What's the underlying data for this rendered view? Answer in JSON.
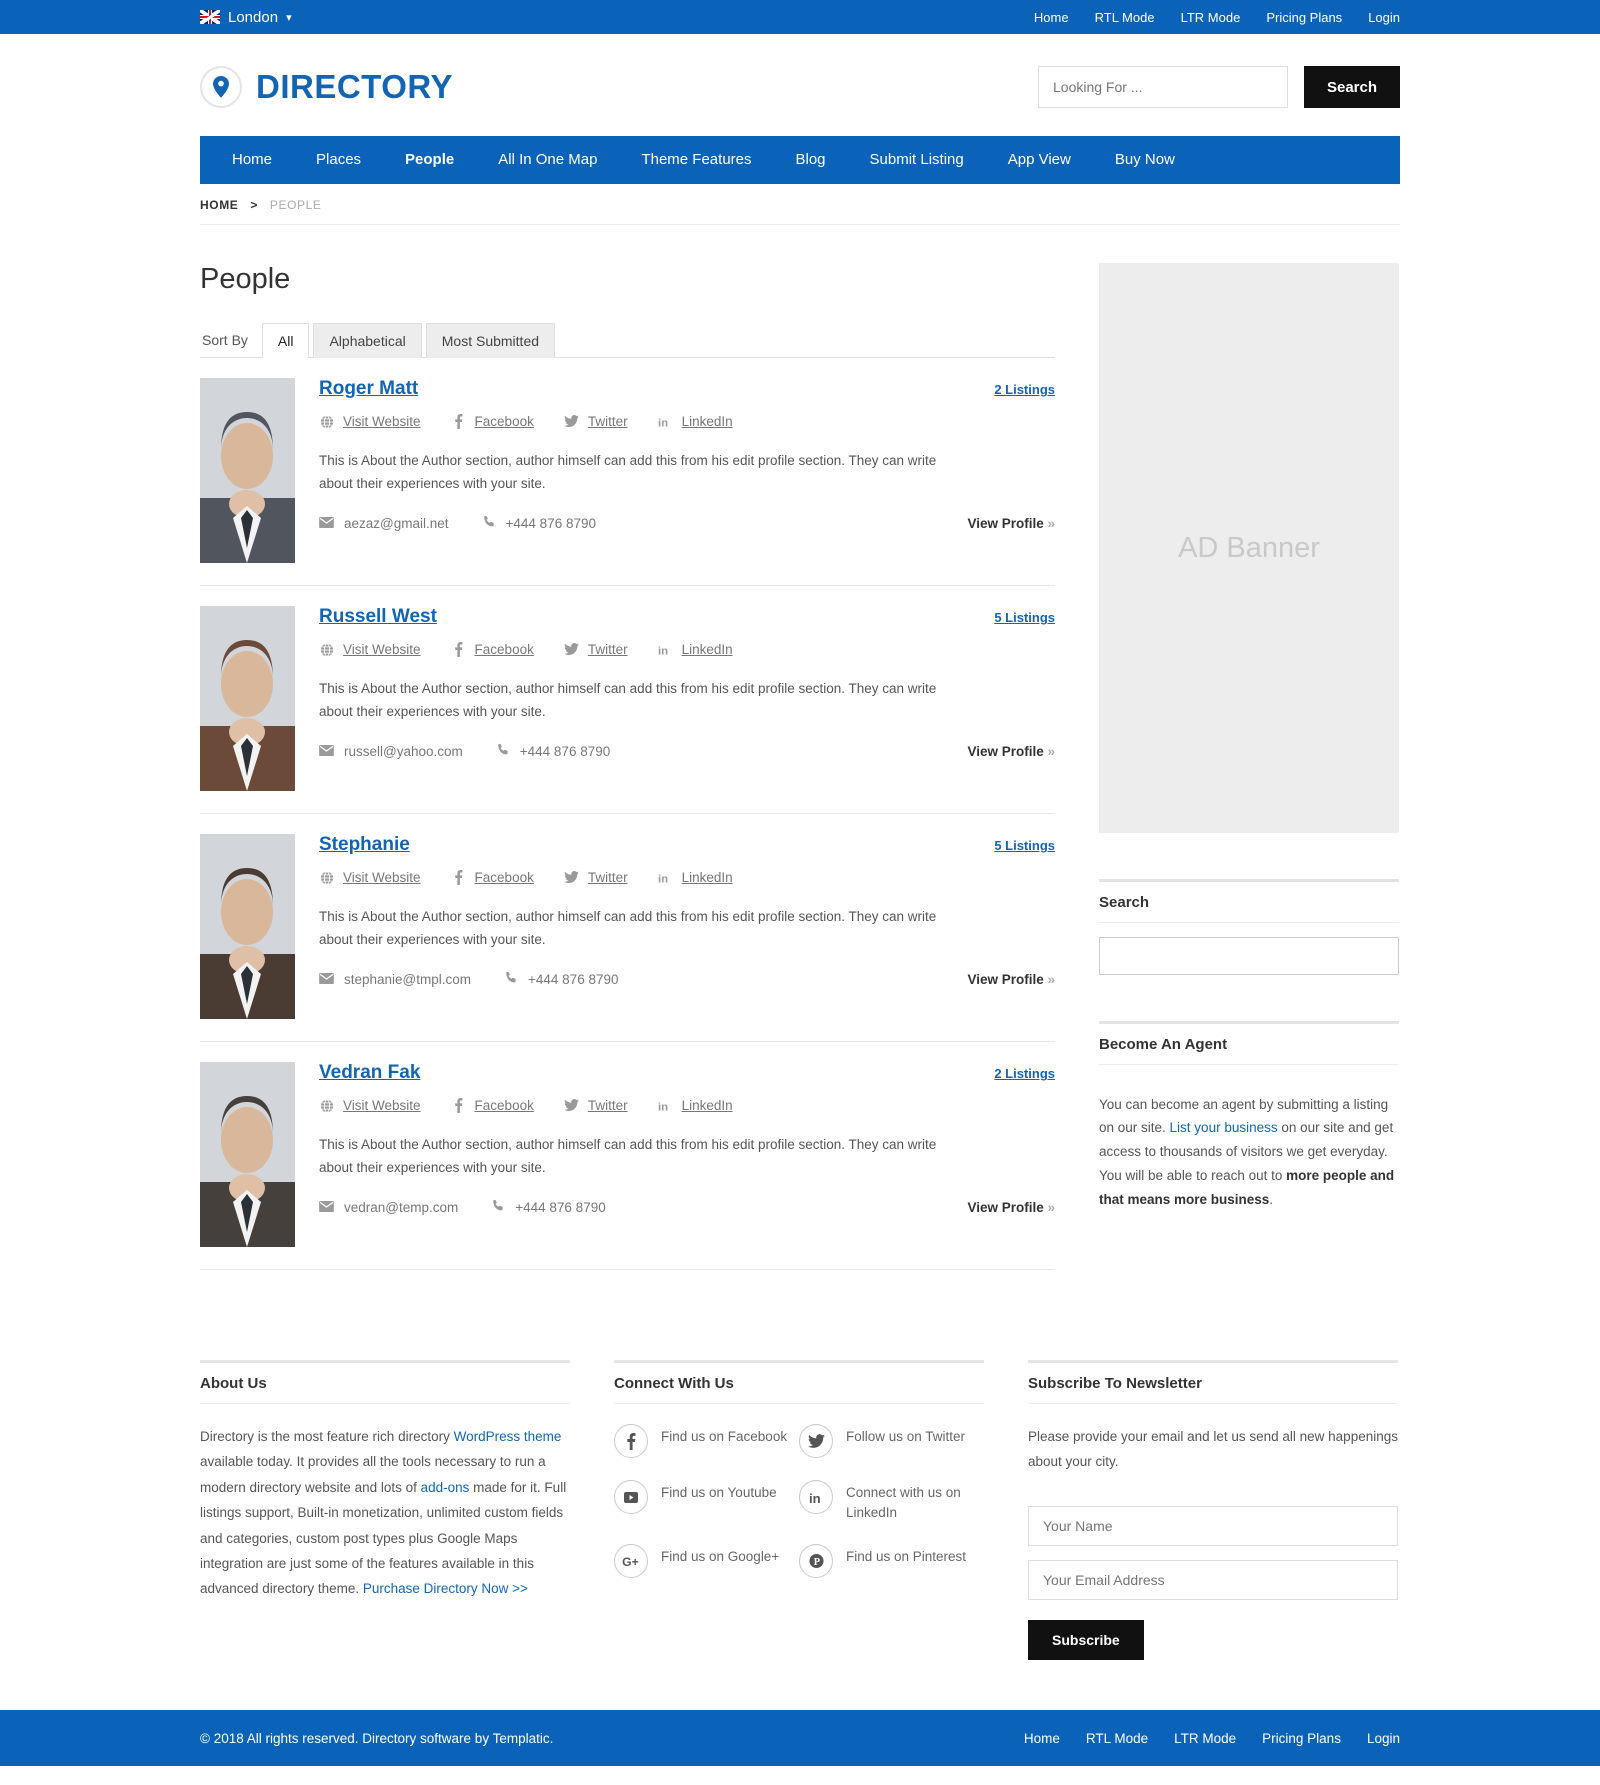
{
  "topbar": {
    "city": "London",
    "flag_icon": "uk-flag-icon",
    "caret_icon": "chevron-down-icon",
    "links": [
      {
        "label": "Home"
      },
      {
        "label": "RTL Mode"
      },
      {
        "label": "LTR Mode"
      },
      {
        "label": "Pricing Plans"
      },
      {
        "label": "Login"
      }
    ]
  },
  "header": {
    "logo_text": "DIRECTORY",
    "logo_icon": "map-pin-icon",
    "search_placeholder": "Looking For ...",
    "search_value": "",
    "search_button": "Search"
  },
  "mainnav": {
    "items": [
      {
        "label": "Home",
        "active": false
      },
      {
        "label": "Places",
        "active": false
      },
      {
        "label": "People",
        "active": true
      },
      {
        "label": "All In One Map",
        "active": false
      },
      {
        "label": "Theme Features",
        "active": false
      },
      {
        "label": "Blog",
        "active": false
      },
      {
        "label": "Submit Listing",
        "active": false
      },
      {
        "label": "App View",
        "active": false
      },
      {
        "label": "Buy Now",
        "active": false
      }
    ]
  },
  "breadcrumb": {
    "home": "HOME",
    "separator": ">",
    "current": "PEOPLE"
  },
  "main": {
    "page_title": "People",
    "sort_label": "Sort By",
    "tabs": [
      {
        "label": "All",
        "active": true
      },
      {
        "label": "Alphabetical",
        "active": false
      },
      {
        "label": "Most Submitted",
        "active": false
      }
    ],
    "social_labels": {
      "website": "Visit Website",
      "facebook": "Facebook",
      "twitter": "Twitter",
      "linkedin": "LinkedIn"
    },
    "view_profile": "View Profile",
    "view_profile_chevron": "»",
    "people": [
      {
        "name": "Roger Matt",
        "listings": "2 Listings",
        "about": "This is About the Author section, author himself can add this from his edit profile section. They can write about their experiences with your site.",
        "email": "aezaz@gmail.net",
        "phone": "+444 876 8790",
        "avatar_color": "#51565e"
      },
      {
        "name": "Russell West",
        "listings": "5 Listings",
        "about": "This is About the Author section, author himself can add this from his edit profile section. They can write about their experiences with your site.",
        "email": "russell@yahoo.com",
        "phone": "+444 876 8790",
        "avatar_color": "#6b4a3a"
      },
      {
        "name": "Stephanie",
        "listings": "5 Listings",
        "about": "This is About the Author section, author himself can add this from his edit profile section. They can write about their experiences with your site.",
        "email": "stephanie@tmpl.com",
        "phone": "+444 876 8790",
        "avatar_color": "#4a3b33"
      },
      {
        "name": "Vedran Fak",
        "listings": "2 Listings",
        "about": "This is About the Author section, author himself can add this from his edit profile section. They can write about their experiences with your site.",
        "email": "vedran@temp.com",
        "phone": "+444 876 8790",
        "avatar_color": "#45403c"
      }
    ]
  },
  "sidebar": {
    "ad_banner": "AD Banner",
    "search_title": "Search",
    "search_value": "",
    "agent_title": "Become An Agent",
    "agent_text_1": "You can become an agent by submitting a listing on our site. ",
    "agent_link": "List your business",
    "agent_text_2": " on our site and get access to thousands of visitors we get everyday. You will be able to reach out to ",
    "agent_bold": "more people and that means more business",
    "agent_text_3": "."
  },
  "footer": {
    "about_title": "About Us",
    "about_p1": "Directory is the most feature rich directory ",
    "about_link1": "WordPress theme",
    "about_p2": " available today. It provides all the tools necessary to run a modern directory website and lots of ",
    "about_link2": "add-ons",
    "about_p3": " made for it. Full listings support, Built-in monetization, unlimited custom fields and categories, custom post types plus Google Maps integration are just some of the features available in this advanced directory theme. ",
    "about_link3": "Purchase Directory Now >>",
    "connect_title": "Connect With Us",
    "socials": [
      {
        "label": "Find us on Facebook",
        "icon": "facebook-icon"
      },
      {
        "label": "Follow us on Twitter",
        "icon": "twitter-icon"
      },
      {
        "label": "Find us on Youtube",
        "icon": "youtube-icon"
      },
      {
        "label": "Connect with us on LinkedIn",
        "icon": "linkedin-icon"
      },
      {
        "label": "Find us on Google+",
        "icon": "googleplus-icon"
      },
      {
        "label": "Find us on Pinterest",
        "icon": "pinterest-icon"
      }
    ],
    "newsletter_title": "Subscribe To Newsletter",
    "newsletter_text": "Please provide your email and let us send all new happenings about your city.",
    "name_placeholder": "Your Name",
    "email_placeholder": "Your Email Address",
    "name_value": "",
    "email_value": "",
    "subscribe_button": "Subscribe"
  },
  "bottombar": {
    "copyright": "© 2018 All rights reserved. Directory software by ",
    "copyright_link": "Templatic",
    "copyright_end": ".",
    "links": [
      {
        "label": "Home"
      },
      {
        "label": "RTL Mode"
      },
      {
        "label": "LTR Mode"
      },
      {
        "label": "Pricing Plans"
      },
      {
        "label": "Login"
      }
    ]
  },
  "colors": {
    "brand_blue": "#0a63b8",
    "link_blue": "#1464b4",
    "dark_button": "#111111"
  }
}
